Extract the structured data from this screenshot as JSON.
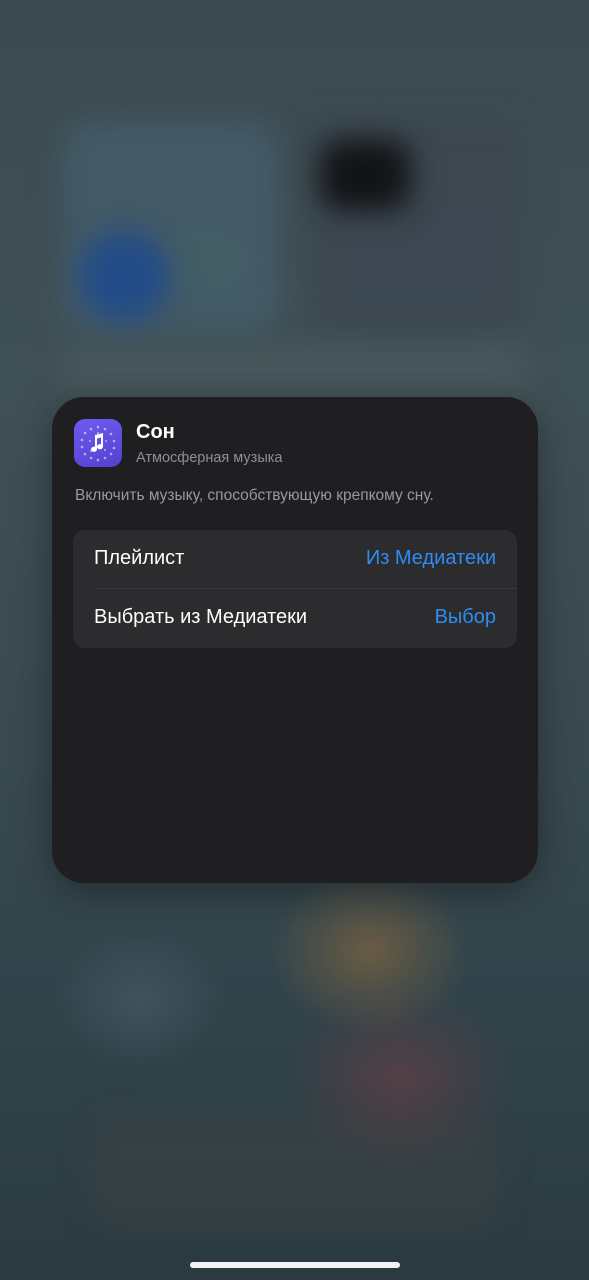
{
  "shortcut": {
    "icon": "music-note-icon",
    "icon_color": "#5f4be3",
    "title": "Сон",
    "subtitle": "Атмосферная музыка",
    "description": "Включить музыку, способствующую крепкому сну."
  },
  "options": [
    {
      "label": "Плейлист",
      "value": "Из Медиатеки"
    },
    {
      "label": "Выбрать из Медиатеки",
      "value": "Выбор"
    }
  ],
  "colors": {
    "card_background": "#1f1f21",
    "row_background": "#2c2c2e",
    "accent": "#2f8cf3"
  }
}
